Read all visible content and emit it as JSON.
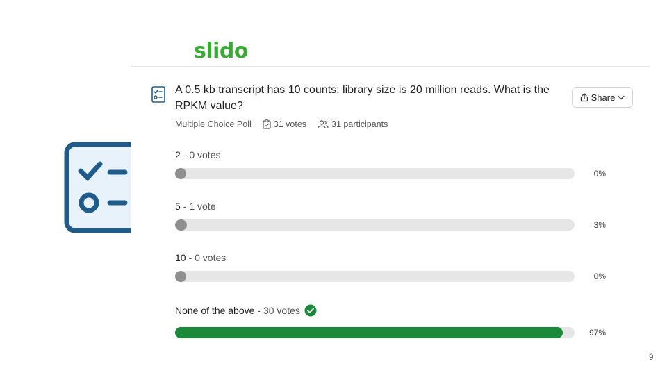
{
  "brand": {
    "logo_text": "slido",
    "logo_color": "#3aaa35"
  },
  "poll": {
    "question": "A 0.5 kb transcript has 10 counts; library size is 20 million reads. What is the RPKM value?",
    "type_label": "Multiple Choice Poll",
    "votes_label": "31 votes",
    "participants_label": "31 participants",
    "share_label": "Share"
  },
  "options": [
    {
      "label": "2",
      "count": "- 0 votes",
      "percent": 0,
      "percent_label": "0%",
      "correct": false
    },
    {
      "label": "5",
      "count": "- 1 vote",
      "percent": 3,
      "percent_label": "3%",
      "correct": false
    },
    {
      "label": "10",
      "count": "- 0 votes",
      "percent": 0,
      "percent_label": "0%",
      "correct": false
    },
    {
      "label": "None of the above",
      "count": "- 30 votes",
      "percent": 97,
      "percent_label": "97%",
      "correct": true
    }
  ],
  "colors": {
    "accent_blue": "#1f5c8a",
    "correct_green": "#1a8a3a",
    "neutral_fill": "#8f8f8f",
    "track": "#e6e6e6"
  },
  "page_number": "9"
}
